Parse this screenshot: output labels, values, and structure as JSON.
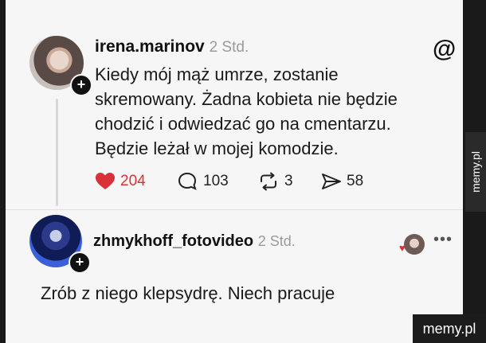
{
  "post": {
    "username": "irena.marinov",
    "time": "2 Std.",
    "text_lines": [
      "Kiedy mój mąż umrze, zostanie",
      "skremowany. Żadna kobieta nie będzie",
      "chodzić i odwiedzać go na cmentarzu.",
      "Będzie leżał w mojej komodzie."
    ],
    "likes": "204",
    "comments": "103",
    "reposts": "3",
    "shares": "58",
    "logo_glyph": "@",
    "plus_glyph": "+"
  },
  "reply": {
    "username": "zhmykhoff_fotovideo",
    "time": "2 Std.",
    "text": "Zrób z niego klepsydrę. Niech pracuje",
    "more_glyph": "•••",
    "plus_glyph": "+"
  },
  "watermarks": {
    "side": "memy.pl",
    "bottom": "memy.pl"
  },
  "colors": {
    "like_red": "#d8313a",
    "card_bg": "#f6f6f6"
  }
}
